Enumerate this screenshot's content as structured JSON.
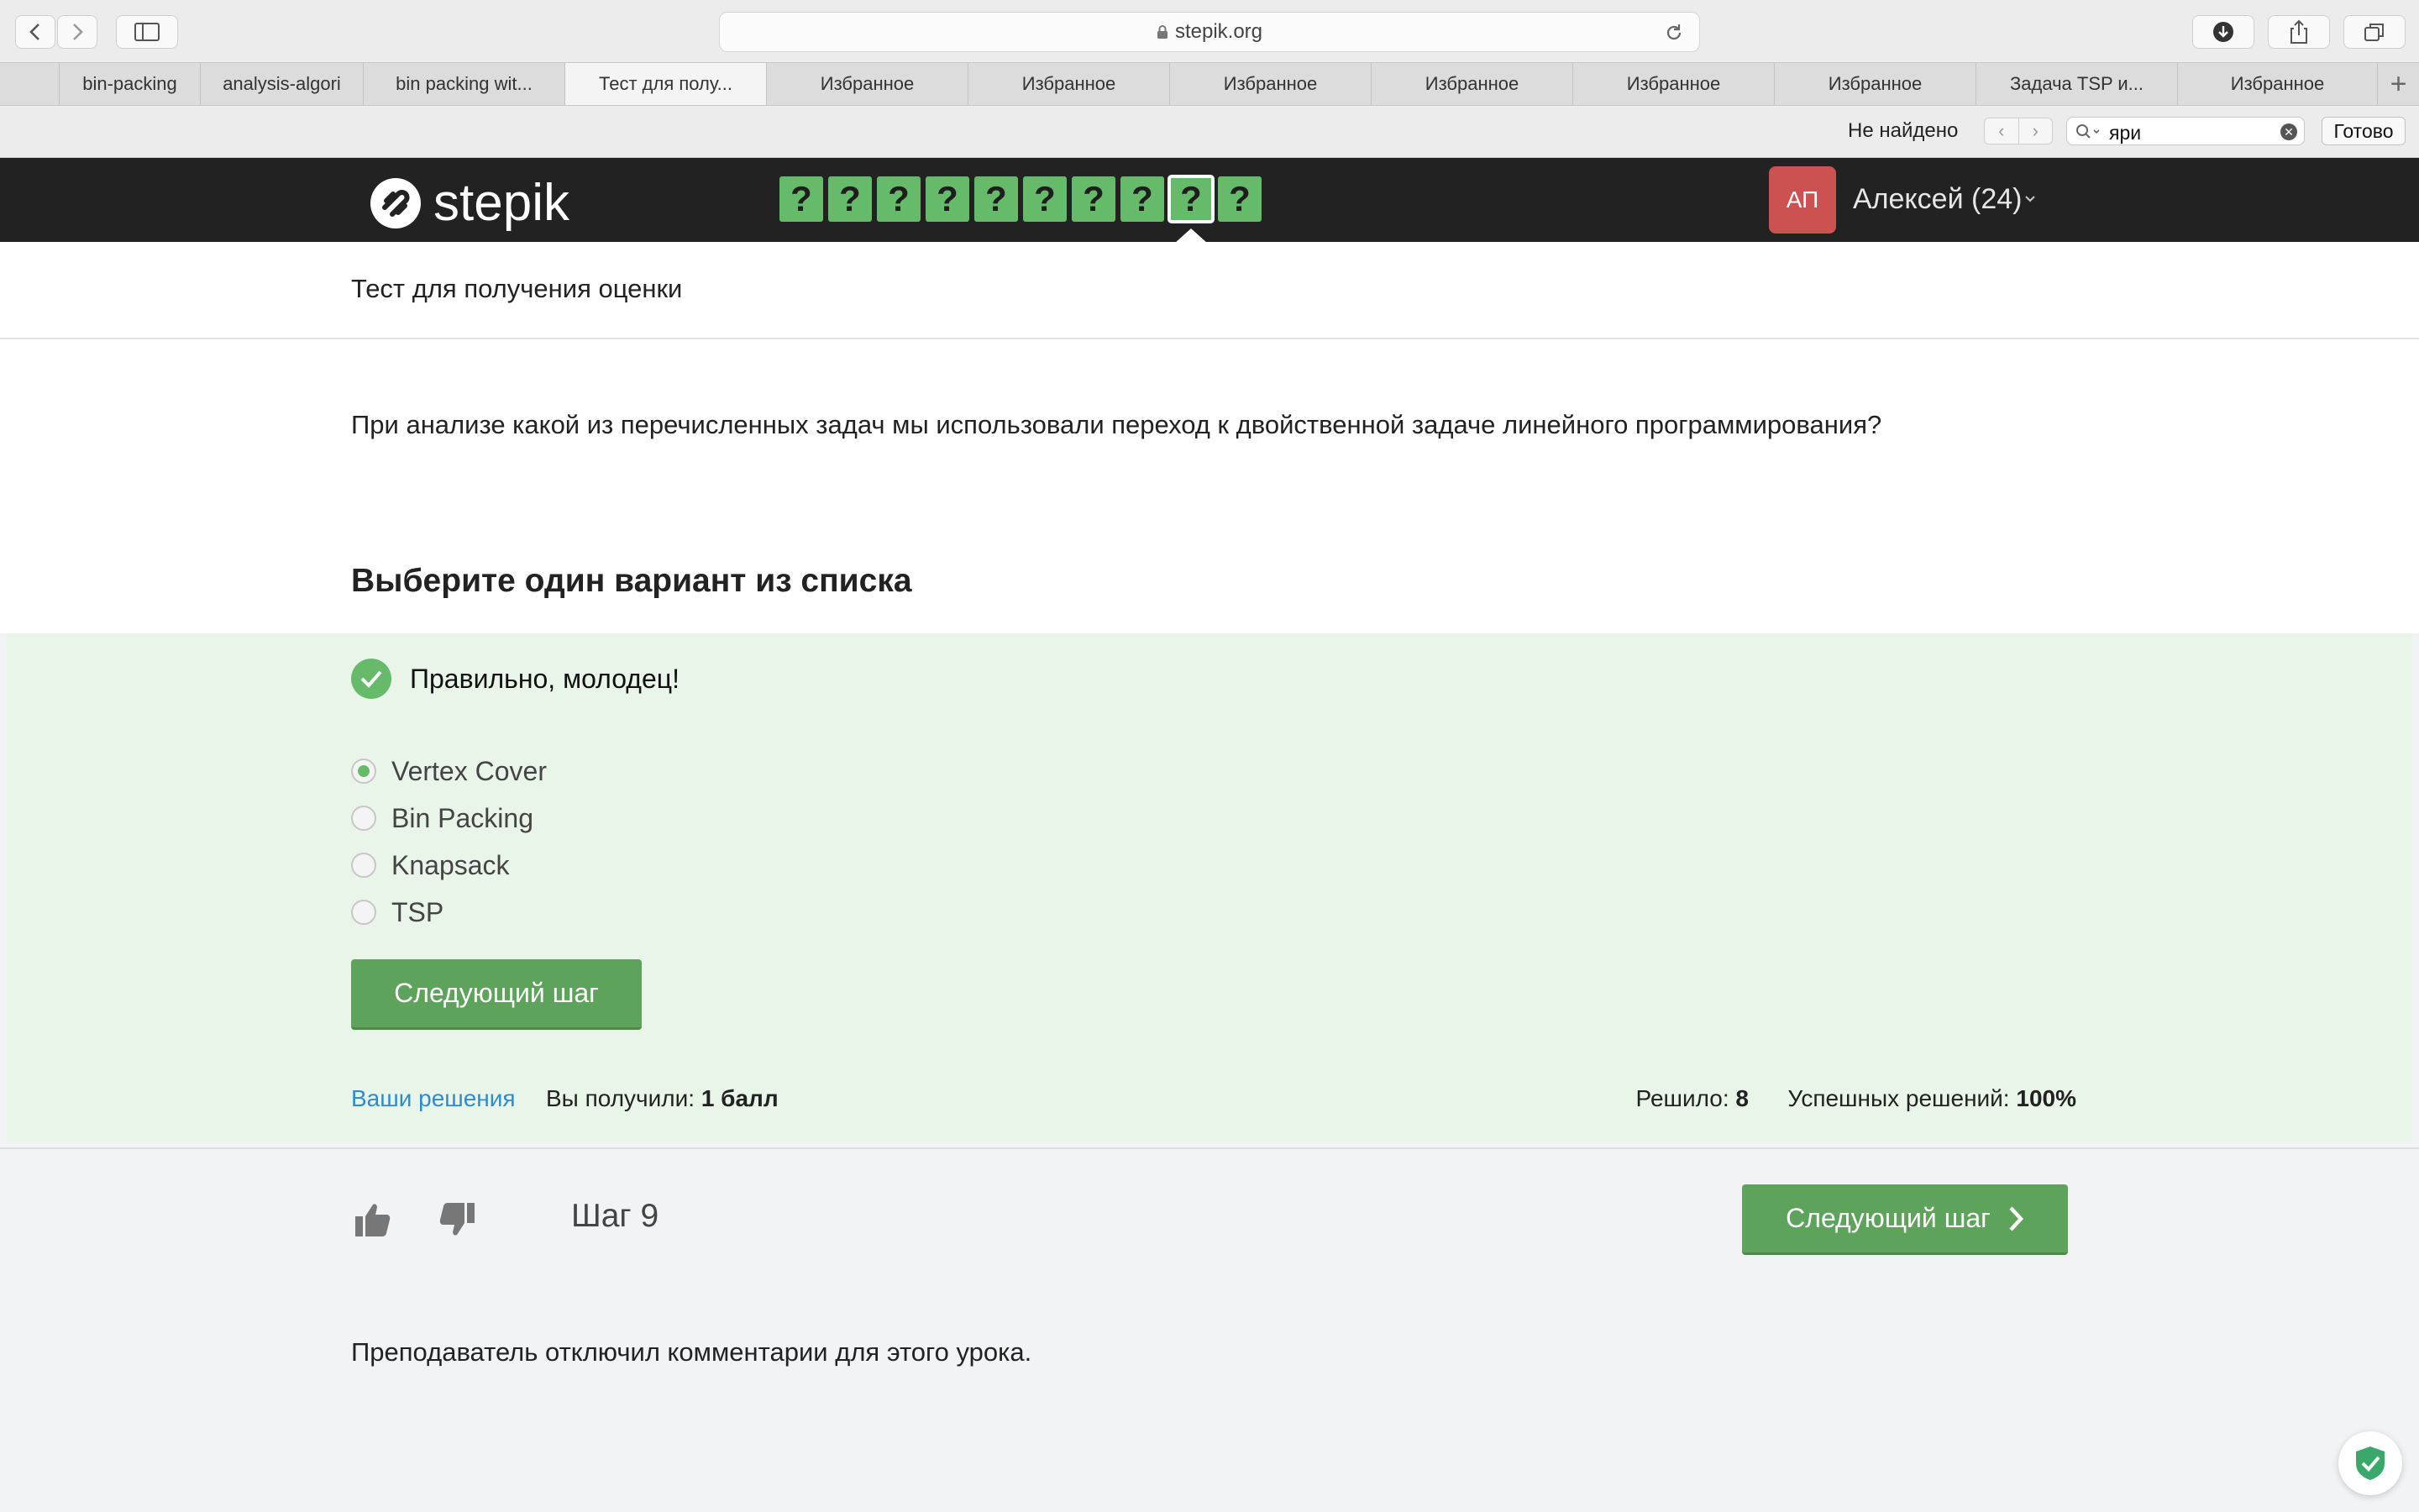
{
  "browser": {
    "url": "stepik.org",
    "tabs": [
      "bin-packing",
      "analysis-algori",
      "bin packing wit...",
      "Тест для полу...",
      "Избранное",
      "Избранное",
      "Избранное",
      "Избранное",
      "Избранное",
      "Избранное",
      "Задача TSP и...",
      "Избранное"
    ],
    "active_tab_index": 3,
    "find": {
      "status": "Не найдено",
      "query": "яри",
      "done_label": "Готово"
    }
  },
  "header": {
    "logo_text": "stepik",
    "step_marks": [
      "?",
      "?",
      "?",
      "?",
      "?",
      "?",
      "?",
      "?",
      "?",
      "?"
    ],
    "current_step_index": 8,
    "avatar_initials": "АП",
    "user_name": "Алексей (24)"
  },
  "lesson": {
    "title": "Тест для получения оценки",
    "question": "При анализе какой из перечисленных задач мы использовали переход к двойственной задаче линейного программирования?",
    "choose_title": "Выберите один вариант из списка",
    "correct_message": "Правильно, молодец!",
    "options": [
      "Vertex Cover",
      "Bin Packing",
      "Knapsack",
      "TSP"
    ],
    "selected_option_index": 0,
    "next_step_label": "Следующий шаг",
    "your_solutions_label": "Ваши решения",
    "got_label": "Вы получили:",
    "got_value": "1 балл",
    "solved_label": "Решило:",
    "solved_value": "8",
    "success_label": "Успешных решений:",
    "success_value": "100%"
  },
  "bottom": {
    "step_label": "Шаг 9",
    "next_step_label": "Следующий шаг",
    "comments_off": "Преподаватель отключил комментарии для этого урока."
  },
  "colors": {
    "brand_green": "#66bb6a",
    "button_green": "#5ea35b",
    "link_blue": "#2d8ccf",
    "avatar_red": "#cc5151",
    "header_dark": "#222222"
  }
}
